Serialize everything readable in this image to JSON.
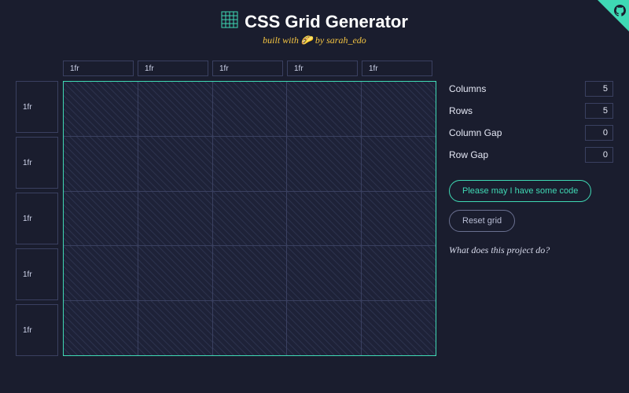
{
  "header": {
    "title": "CSS Grid Generator",
    "subtitle_prefix": "built with ",
    "subtitle_suffix": " by sarah_edo"
  },
  "grid": {
    "columns": 5,
    "rows": 5,
    "col_tracks": [
      "1fr",
      "1fr",
      "1fr",
      "1fr",
      "1fr"
    ],
    "row_tracks": [
      "1fr",
      "1fr",
      "1fr",
      "1fr",
      "1fr"
    ]
  },
  "controls": {
    "columns_label": "Columns",
    "columns_value": "5",
    "rows_label": "Rows",
    "rows_value": "5",
    "col_gap_label": "Column Gap",
    "col_gap_value": "0",
    "row_gap_label": "Row Gap",
    "row_gap_value": "0",
    "code_button": "Please may I have some code",
    "reset_button": "Reset grid",
    "info_link": "What does this project do?"
  },
  "colors": {
    "accent": "#3fd9b4",
    "bg": "#1a1d2e"
  }
}
